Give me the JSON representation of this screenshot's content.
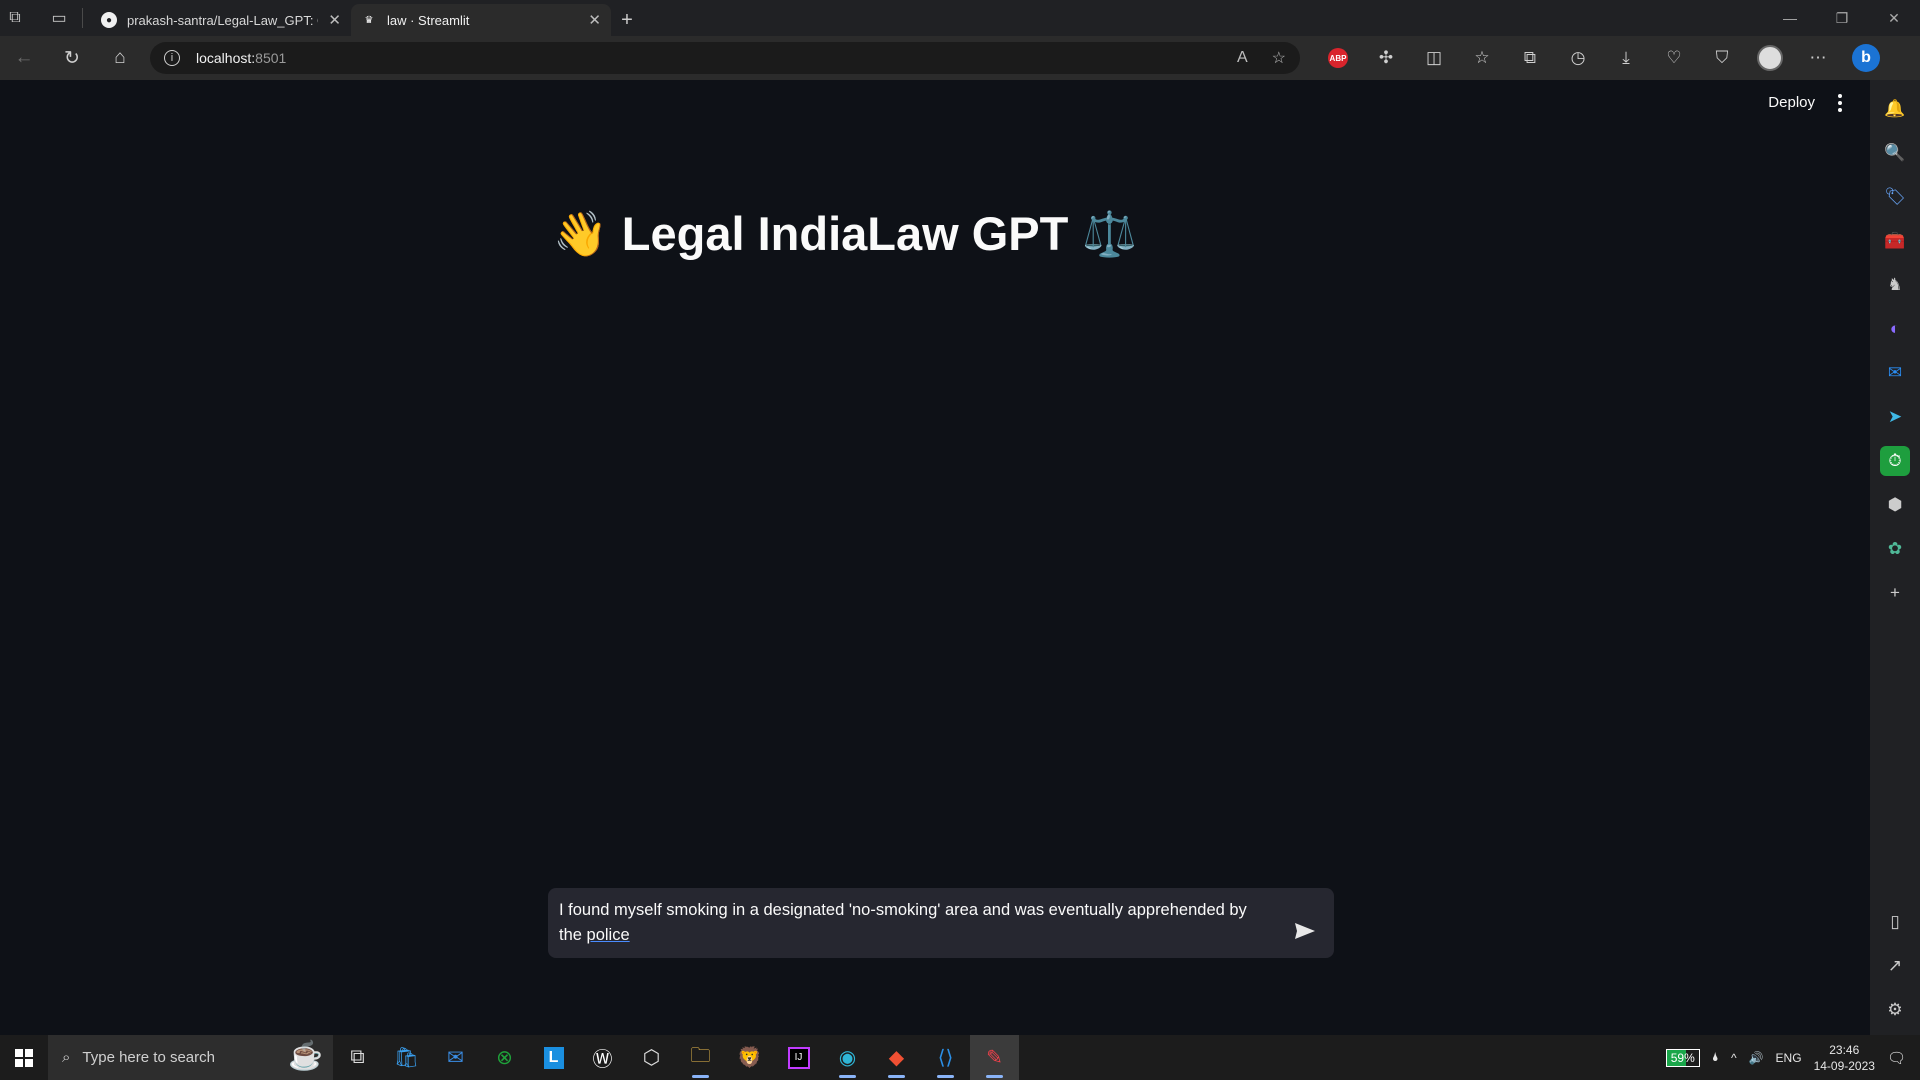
{
  "browser": {
    "tabs": [
      {
        "title": "prakash-santra/Legal-Law_GPT: G",
        "favicon": "github-icon",
        "active": false
      },
      {
        "title": "law · Streamlit",
        "favicon": "streamlit-icon",
        "active": true
      }
    ],
    "url_host": "localhost:",
    "url_port": "8501",
    "accent": "#1b73d4"
  },
  "app": {
    "deploy_label": "Deploy",
    "title_emoji_left": "👋",
    "title_text": "Legal IndiaLaw GPT",
    "title_emoji_right": "⚖️",
    "chat_input_text_before": "I found myself smoking in a designated 'no-smoking' area and was eventually apprehended by the ",
    "chat_input_text_underlined": "police"
  },
  "taskbar": {
    "search_placeholder": "Type here to search",
    "battery": "59%",
    "language": "ENG",
    "time": "23:46",
    "date": "14-09-2023"
  }
}
